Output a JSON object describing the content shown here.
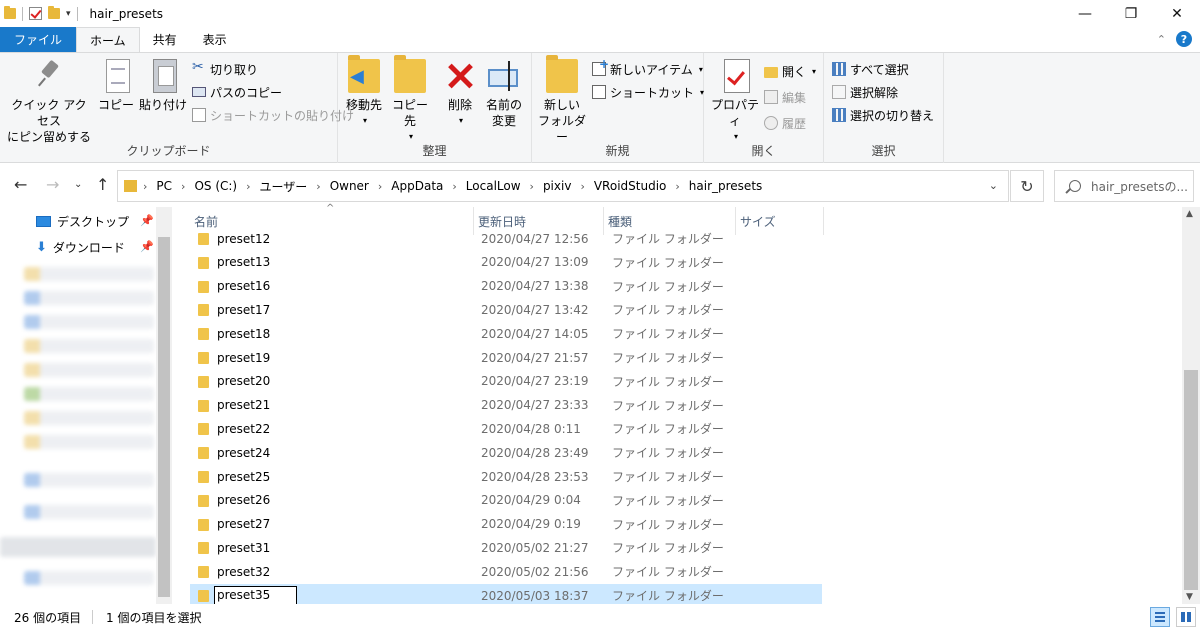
{
  "window": {
    "title": "hair_presets",
    "qa_dropdown": "▾",
    "controls": {
      "minimize": "—",
      "maximize": "❐",
      "close": "✕"
    }
  },
  "tabs": [
    {
      "label": "ファイル"
    },
    {
      "label": "ホーム"
    },
    {
      "label": "共有"
    },
    {
      "label": "表示"
    }
  ],
  "ribbon": {
    "clipboard": {
      "label": "クリップボード",
      "pin_label_1": "クイック アクセス",
      "pin_label_2": "にピン留めする",
      "copy": "コピー",
      "paste": "貼り付け",
      "cut": "切り取り",
      "copy_path": "パスのコピー",
      "paste_shortcut": "ショートカットの貼り付け"
    },
    "organize": {
      "label": "整理",
      "move_to": "移動先",
      "copy_to": "コピー先",
      "delete": "削除",
      "rename_1": "名前の",
      "rename_2": "変更"
    },
    "new": {
      "label": "新規",
      "new_folder_1": "新しい",
      "new_folder_2": "フォルダー",
      "new_item": "新しいアイテム",
      "shortcut": "ショートカット"
    },
    "open": {
      "label": "開く",
      "properties": "プロパティ",
      "open": "開く",
      "edit": "編集",
      "history": "履歴"
    },
    "select": {
      "label": "選択",
      "select_all": "すべて選択",
      "select_none": "選択解除",
      "invert": "選択の切り替え"
    }
  },
  "address": {
    "crumbs": [
      "PC",
      "OS (C:)",
      "ユーザー",
      "Owner",
      "AppData",
      "LocalLow",
      "pixiv",
      "VRoidStudio",
      "hair_presets"
    ],
    "search_placeholder": "hair_presetsの..."
  },
  "sidebar": {
    "items": [
      {
        "label": "デスクトップ",
        "icon": "desktop-icon"
      },
      {
        "label": "ダウンロード",
        "icon": "download-icon"
      }
    ]
  },
  "columns": {
    "name": "名前",
    "date": "更新日時",
    "type": "種類",
    "size": "サイズ"
  },
  "files": [
    {
      "name": "preset12",
      "date": "2020/04/27 12:56",
      "type": "ファイル フォルダー"
    },
    {
      "name": "preset13",
      "date": "2020/04/27 13:09",
      "type": "ファイル フォルダー"
    },
    {
      "name": "preset16",
      "date": "2020/04/27 13:38",
      "type": "ファイル フォルダー"
    },
    {
      "name": "preset17",
      "date": "2020/04/27 13:42",
      "type": "ファイル フォルダー"
    },
    {
      "name": "preset18",
      "date": "2020/04/27 14:05",
      "type": "ファイル フォルダー"
    },
    {
      "name": "preset19",
      "date": "2020/04/27 21:57",
      "type": "ファイル フォルダー"
    },
    {
      "name": "preset20",
      "date": "2020/04/27 23:19",
      "type": "ファイル フォルダー"
    },
    {
      "name": "preset21",
      "date": "2020/04/27 23:33",
      "type": "ファイル フォルダー"
    },
    {
      "name": "preset22",
      "date": "2020/04/28 0:11",
      "type": "ファイル フォルダー"
    },
    {
      "name": "preset24",
      "date": "2020/04/28 23:49",
      "type": "ファイル フォルダー"
    },
    {
      "name": "preset25",
      "date": "2020/04/28 23:53",
      "type": "ファイル フォルダー"
    },
    {
      "name": "preset26",
      "date": "2020/04/29 0:04",
      "type": "ファイル フォルダー"
    },
    {
      "name": "preset27",
      "date": "2020/04/29 0:19",
      "type": "ファイル フォルダー"
    },
    {
      "name": "preset31",
      "date": "2020/05/02 21:27",
      "type": "ファイル フォルダー"
    },
    {
      "name": "preset32",
      "date": "2020/05/02 21:56",
      "type": "ファイル フォルダー"
    },
    {
      "name": "preset35",
      "date": "2020/05/03 18:37",
      "type": "ファイル フォルダー",
      "selected": true,
      "renaming": true
    }
  ],
  "status": {
    "count": "26 個の項目",
    "selected": "1 個の項目を選択"
  }
}
